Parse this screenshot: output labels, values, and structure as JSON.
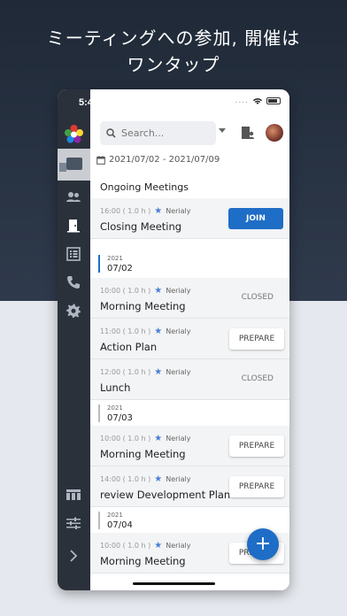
{
  "headline": {
    "line1": "ミーティングへの参加, 開催は",
    "line2": "ワンタップ"
  },
  "status_bar": {
    "time": "5:43",
    "dots": "...."
  },
  "colors": {
    "accent": "#1e6dc6",
    "sidebar": "#2b313b"
  },
  "sidebar": {
    "items": [
      {
        "icon": "people-icon"
      },
      {
        "icon": "door-icon"
      },
      {
        "icon": "list-icon"
      },
      {
        "icon": "phone-icon"
      },
      {
        "icon": "gear-icon"
      },
      {
        "icon": "grid-icon"
      },
      {
        "icon": "sliders-icon"
      },
      {
        "icon": "chevron-right-icon"
      }
    ]
  },
  "search": {
    "placeholder": "Search..."
  },
  "date_range": "2021/07/02 - 2021/07/09",
  "ongoing": {
    "title": "Ongoing Meetings",
    "meeting": {
      "time": "16:00 ( 1.0 h )",
      "host": "Nerialy",
      "title": "Closing Meeting",
      "action": "JOIN"
    }
  },
  "days": [
    {
      "year": "2021",
      "date": "07/02",
      "meetings": [
        {
          "time": "10:00 ( 1.0 h )",
          "host": "Nerialy",
          "title": "Morning Meeting",
          "action": "CLOSED"
        },
        {
          "time": "11:00 ( 1.0 h )",
          "host": "Nerialy",
          "title": "Action Plan",
          "action": "PREPARE"
        },
        {
          "time": "12:00 ( 1.0 h )",
          "host": "Nerialy",
          "title": "Lunch",
          "action": "CLOSED"
        }
      ]
    },
    {
      "year": "2021",
      "date": "07/03",
      "meetings": [
        {
          "time": "10:00 ( 1.0 h )",
          "host": "Nerialy",
          "title": "Morning Meeting",
          "action": "PREPARE"
        },
        {
          "time": "14:00 ( 1.0 h )",
          "host": "Nerialy",
          "title": "review Development Plan",
          "action": "PREPARE"
        }
      ]
    },
    {
      "year": "2021",
      "date": "07/04",
      "meetings": [
        {
          "time": "10:00 ( 1.0 h )",
          "host": "Nerialy",
          "title": "Morning Meeting",
          "action": "PREPARE"
        }
      ]
    }
  ],
  "fab": "+"
}
